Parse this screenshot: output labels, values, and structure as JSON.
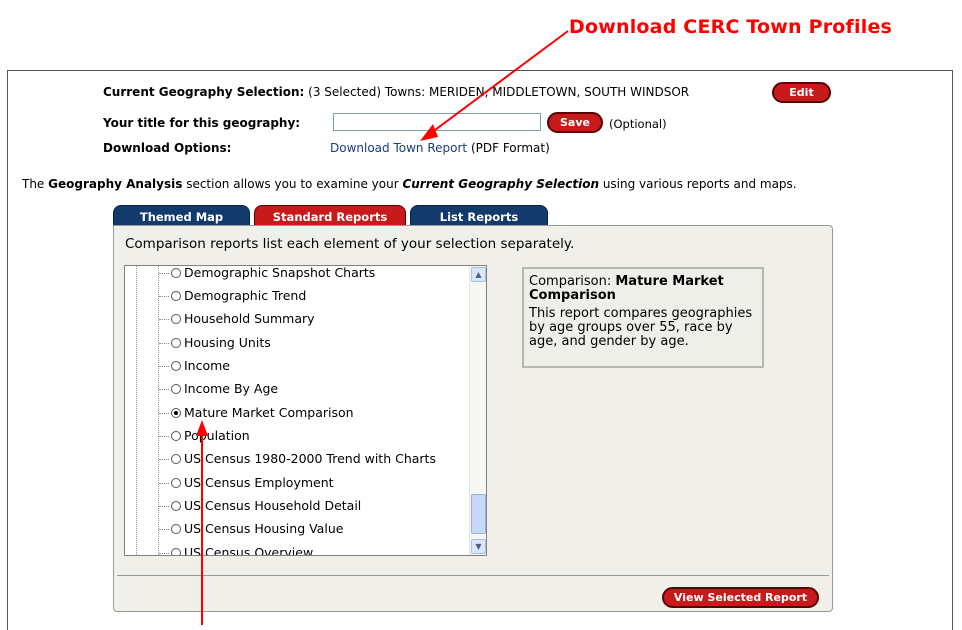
{
  "callout": {
    "text": "Download CERC Town Profiles"
  },
  "geography": {
    "current_label": "Current Geography Selection:",
    "current_value": "(3 Selected) Towns: MERIDEN, MIDDLETOWN, SOUTH WINDSOR",
    "edit_label": "Edit",
    "title_label": "Your title for this geography:",
    "title_value": "",
    "save_label": "Save",
    "optional_text": "(Optional)",
    "download_label": "Download Options:",
    "download_link": "Download Town Report",
    "download_format": "(PDF Format)"
  },
  "intro": {
    "prefix": "The ",
    "section": "Geography Analysis",
    "middle": " section allows you to examine your ",
    "selection": "Current Geography Selection",
    "suffix": " using various reports and maps."
  },
  "tabs": [
    {
      "label": "Themed Map",
      "color": "#133a6d",
      "active": false
    },
    {
      "label": "Standard Reports",
      "color": "#c81a1a",
      "active": true
    },
    {
      "label": "List Reports",
      "color": "#133a6d",
      "active": false
    }
  ],
  "panel": {
    "description": "Comparison reports list each element of your selection separately.",
    "reports": [
      {
        "label": "Demographic Snapshot Charts",
        "selected": false
      },
      {
        "label": "Demographic Trend",
        "selected": false
      },
      {
        "label": "Household Summary",
        "selected": false
      },
      {
        "label": "Housing Units",
        "selected": false
      },
      {
        "label": "Income",
        "selected": false
      },
      {
        "label": "Income By Age",
        "selected": false
      },
      {
        "label": "Mature Market Comparison",
        "selected": true
      },
      {
        "label": "Population",
        "selected": false
      },
      {
        "label": "US Census 1980-2000 Trend with Charts",
        "selected": false
      },
      {
        "label": "US Census Employment",
        "selected": false
      },
      {
        "label": "US Census Household Detail",
        "selected": false
      },
      {
        "label": "US Census Housing Value",
        "selected": false
      },
      {
        "label": "US Census Overview",
        "selected": false
      }
    ],
    "info": {
      "prefix": "Comparison: ",
      "title": "Mature Market Comparison",
      "body": "This report compares geographies by age groups over 55, race by age, and gender by age."
    },
    "view_button": "View Selected Report"
  },
  "colors": {
    "accent_red": "#c81a1a",
    "navy": "#133a6d",
    "annotation_red": "#ff0000"
  }
}
